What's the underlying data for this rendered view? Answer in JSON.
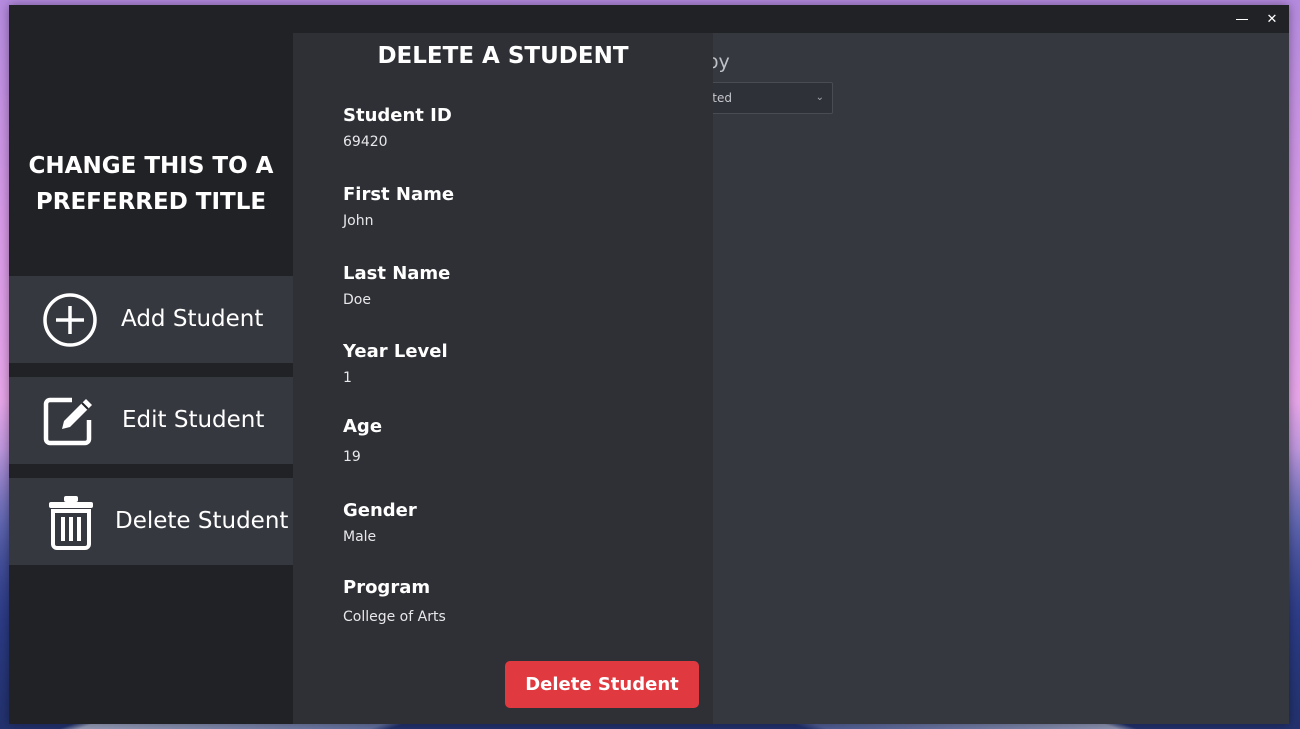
{
  "app": {
    "title": "CHANGE THIS TO A PREFERRED TITLE"
  },
  "window_controls": {
    "minimize_icon": "minimize-icon",
    "close_label": "✕"
  },
  "sidebar": {
    "items": [
      {
        "label": "Add Student",
        "icon": "plus-circle-icon"
      },
      {
        "label": "Edit Student",
        "icon": "edit-icon"
      },
      {
        "label": "Delete Student",
        "icon": "trash-icon"
      }
    ]
  },
  "main": {
    "sort_label": "t by",
    "sort_select_value": "orted"
  },
  "panel": {
    "title": "DELETE A STUDENT",
    "fields": [
      {
        "label": "Student ID",
        "value": "69420"
      },
      {
        "label": "First Name",
        "value": "John"
      },
      {
        "label": "Last Name",
        "value": "Doe"
      },
      {
        "label": "Year Level",
        "value": "1"
      },
      {
        "label": "Age",
        "value": "19"
      },
      {
        "label": "Gender",
        "value": "Male"
      },
      {
        "label": "Program",
        "value": "College of Arts"
      }
    ],
    "delete_button_label": "Delete Student"
  },
  "colors": {
    "sidebar_bg": "#212226",
    "nav_item_bg": "#363840",
    "panel_bg": "#2f3036",
    "danger": "#e0393f"
  }
}
